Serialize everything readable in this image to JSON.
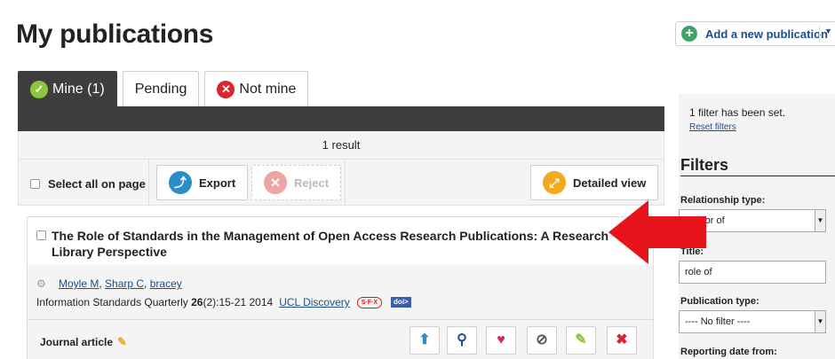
{
  "header": {
    "title": "My publications",
    "add_publication_label": "Add a new publication"
  },
  "tabs": [
    {
      "label": "Mine (1)",
      "icon": "check-circle-icon",
      "active": true
    },
    {
      "label": "Pending",
      "active": false
    },
    {
      "label": "Not mine",
      "icon": "x-circle-icon",
      "active": false
    }
  ],
  "results": {
    "text": "1 result"
  },
  "toolbar": {
    "select_all_label": "Select all on page",
    "export_label": "Export",
    "reject_label": "Reject",
    "detailed_view_label": "Detailed view"
  },
  "publication": {
    "title": "The Role of Standards in the Management of Open Access Research Publications: A Research Library Perspective",
    "authors": [
      "Moyle M",
      "Sharp C",
      "bracey"
    ],
    "journal": "Information Standards Quarterly",
    "volume": "26",
    "issue_pages": "(2):15-21 2014",
    "repository_link": "UCL Discovery",
    "sfx_label": "S·F·X",
    "doi_label": "doi>",
    "type": "Journal article"
  },
  "sidebar": {
    "filter_status": "1 filter has been set.",
    "reset_label": "Reset filters",
    "filters_heading": "Filters",
    "relationship_label": "Relationship type:",
    "relationship_value": "Author of",
    "title_label": "Title:",
    "title_value": "role of",
    "pubtype_label": "Publication type:",
    "pubtype_value": "---- No filter ----",
    "reporting_label": "Reporting date from:"
  },
  "colors": {
    "accent_green": "#8cc63f",
    "reject_red": "#d7282f",
    "link_blue": "#1a4f8a",
    "arrow_red": "#e8141b"
  }
}
